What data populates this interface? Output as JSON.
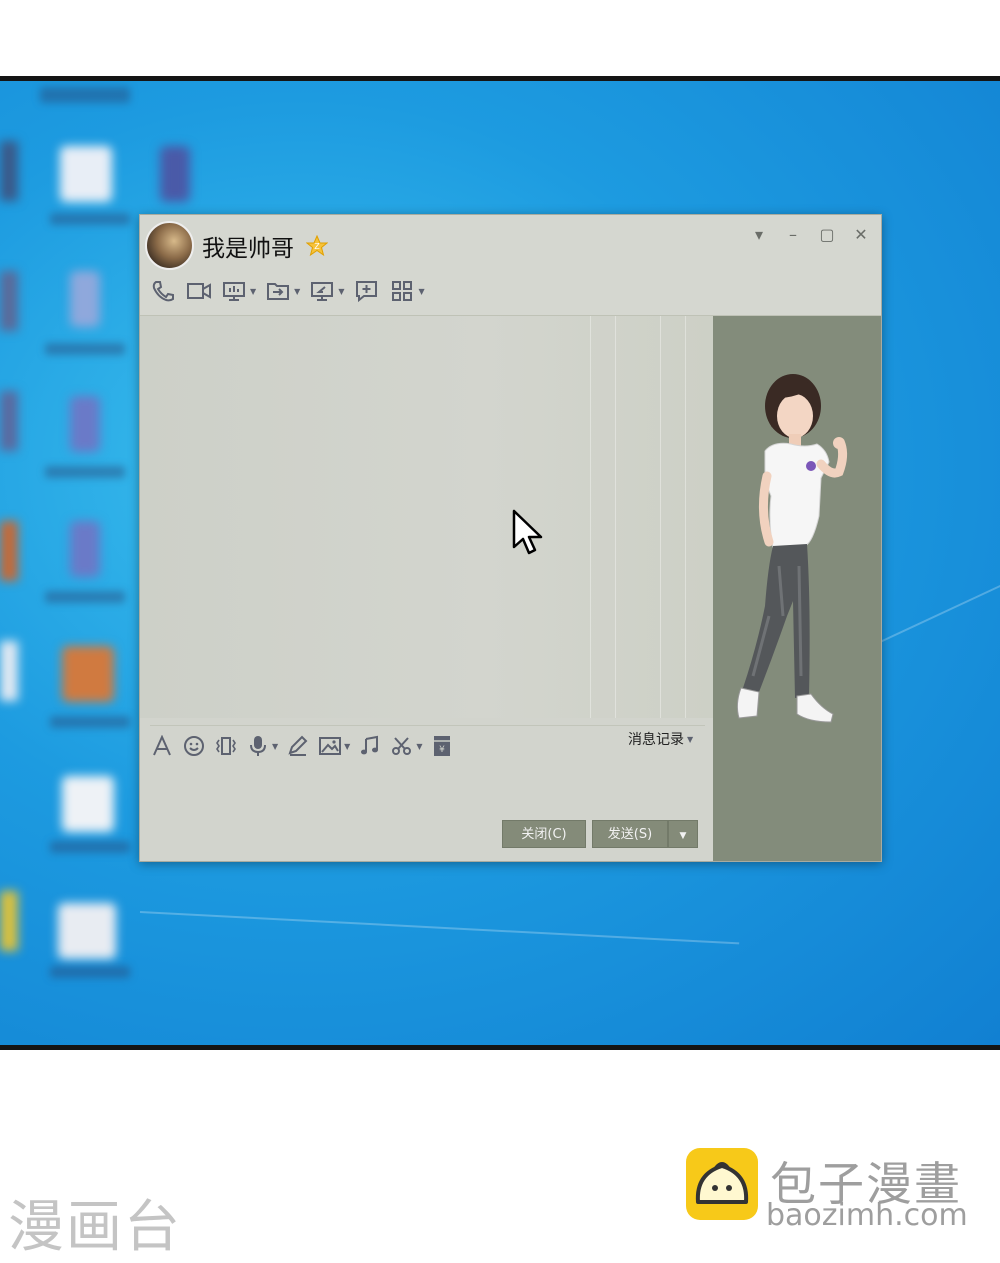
{
  "chat_window": {
    "contact_name": "我是帅哥",
    "buttons": {
      "close": "关闭(C)",
      "send": "发送(S)"
    },
    "message_history": "消息记录"
  },
  "toolbar_top_icons": [
    "phone-icon",
    "video-icon",
    "screen-share-icon",
    "file-transfer-icon",
    "remote-desktop-icon",
    "new-discussion-icon",
    "apps-icon"
  ],
  "input_toolbar_icons": [
    "font-icon",
    "emoji-icon",
    "shake-icon",
    "voice-icon",
    "doodle-icon",
    "image-icon",
    "music-icon",
    "screenshot-icon",
    "red-packet-icon"
  ],
  "watermarks": {
    "left": "漫画台",
    "brand_title": "包子漫畫",
    "brand_url": "baozimh.com"
  },
  "colors": {
    "desktop_blue": "#1d9be0",
    "window_bg": "#d2d4cd",
    "side_panel": "#838c7b",
    "button_bg": "#848b79",
    "brand_yellow": "#f7c919"
  }
}
